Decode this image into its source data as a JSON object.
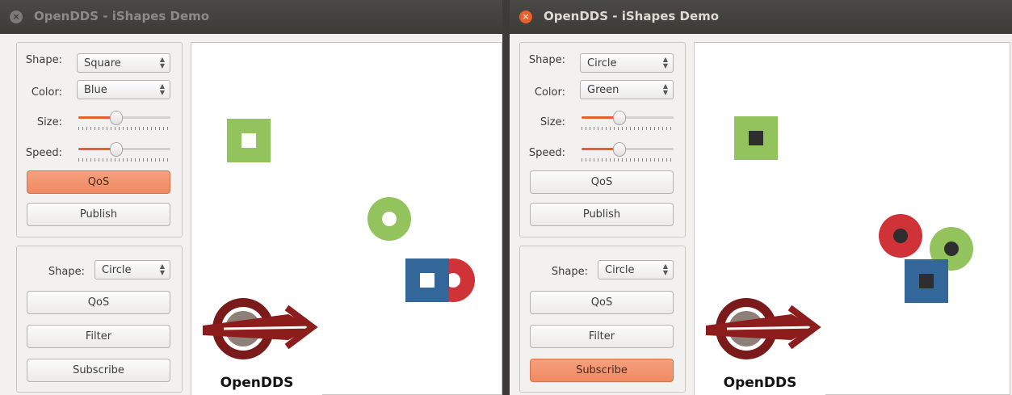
{
  "windows": [
    {
      "id": "left",
      "title": "OpenDDS - iShapes Demo",
      "publisher": {
        "shape_label": "Shape:",
        "shape_value": "Square",
        "color_label": "Color:",
        "color_value": "Blue",
        "size_label": "Size:",
        "size_level": 0.4,
        "speed_label": "Speed:",
        "speed_level": 0.4,
        "qos_label": "QoS",
        "qos_active": true,
        "publish_label": "Publish"
      },
      "subscriber": {
        "shape_label": "Shape:",
        "shape_value": "Circle",
        "qos_label": "QoS",
        "filter_label": "Filter",
        "subscribe_label": "Subscribe",
        "subscribe_active": false
      },
      "logo_text": "OpenDDS"
    },
    {
      "id": "right",
      "title": "OpenDDS - iShapes Demo",
      "publisher": {
        "shape_label": "Shape:",
        "shape_value": "Circle",
        "color_label": "Color:",
        "color_value": "Green",
        "size_label": "Size:",
        "size_level": 0.4,
        "speed_label": "Speed:",
        "speed_level": 0.4,
        "qos_label": "QoS",
        "qos_active": false,
        "publish_label": "Publish"
      },
      "subscriber": {
        "shape_label": "Shape:",
        "shape_value": "Circle",
        "qos_label": "QoS",
        "filter_label": "Filter",
        "subscribe_label": "Subscribe",
        "subscribe_active": true
      },
      "logo_text": "OpenDDS"
    }
  ],
  "colors": {
    "green": "#92c35c",
    "blue": "#336699",
    "red": "#cf3337",
    "accent": "#f08a63",
    "dark_inner": "#2e2e2e"
  }
}
